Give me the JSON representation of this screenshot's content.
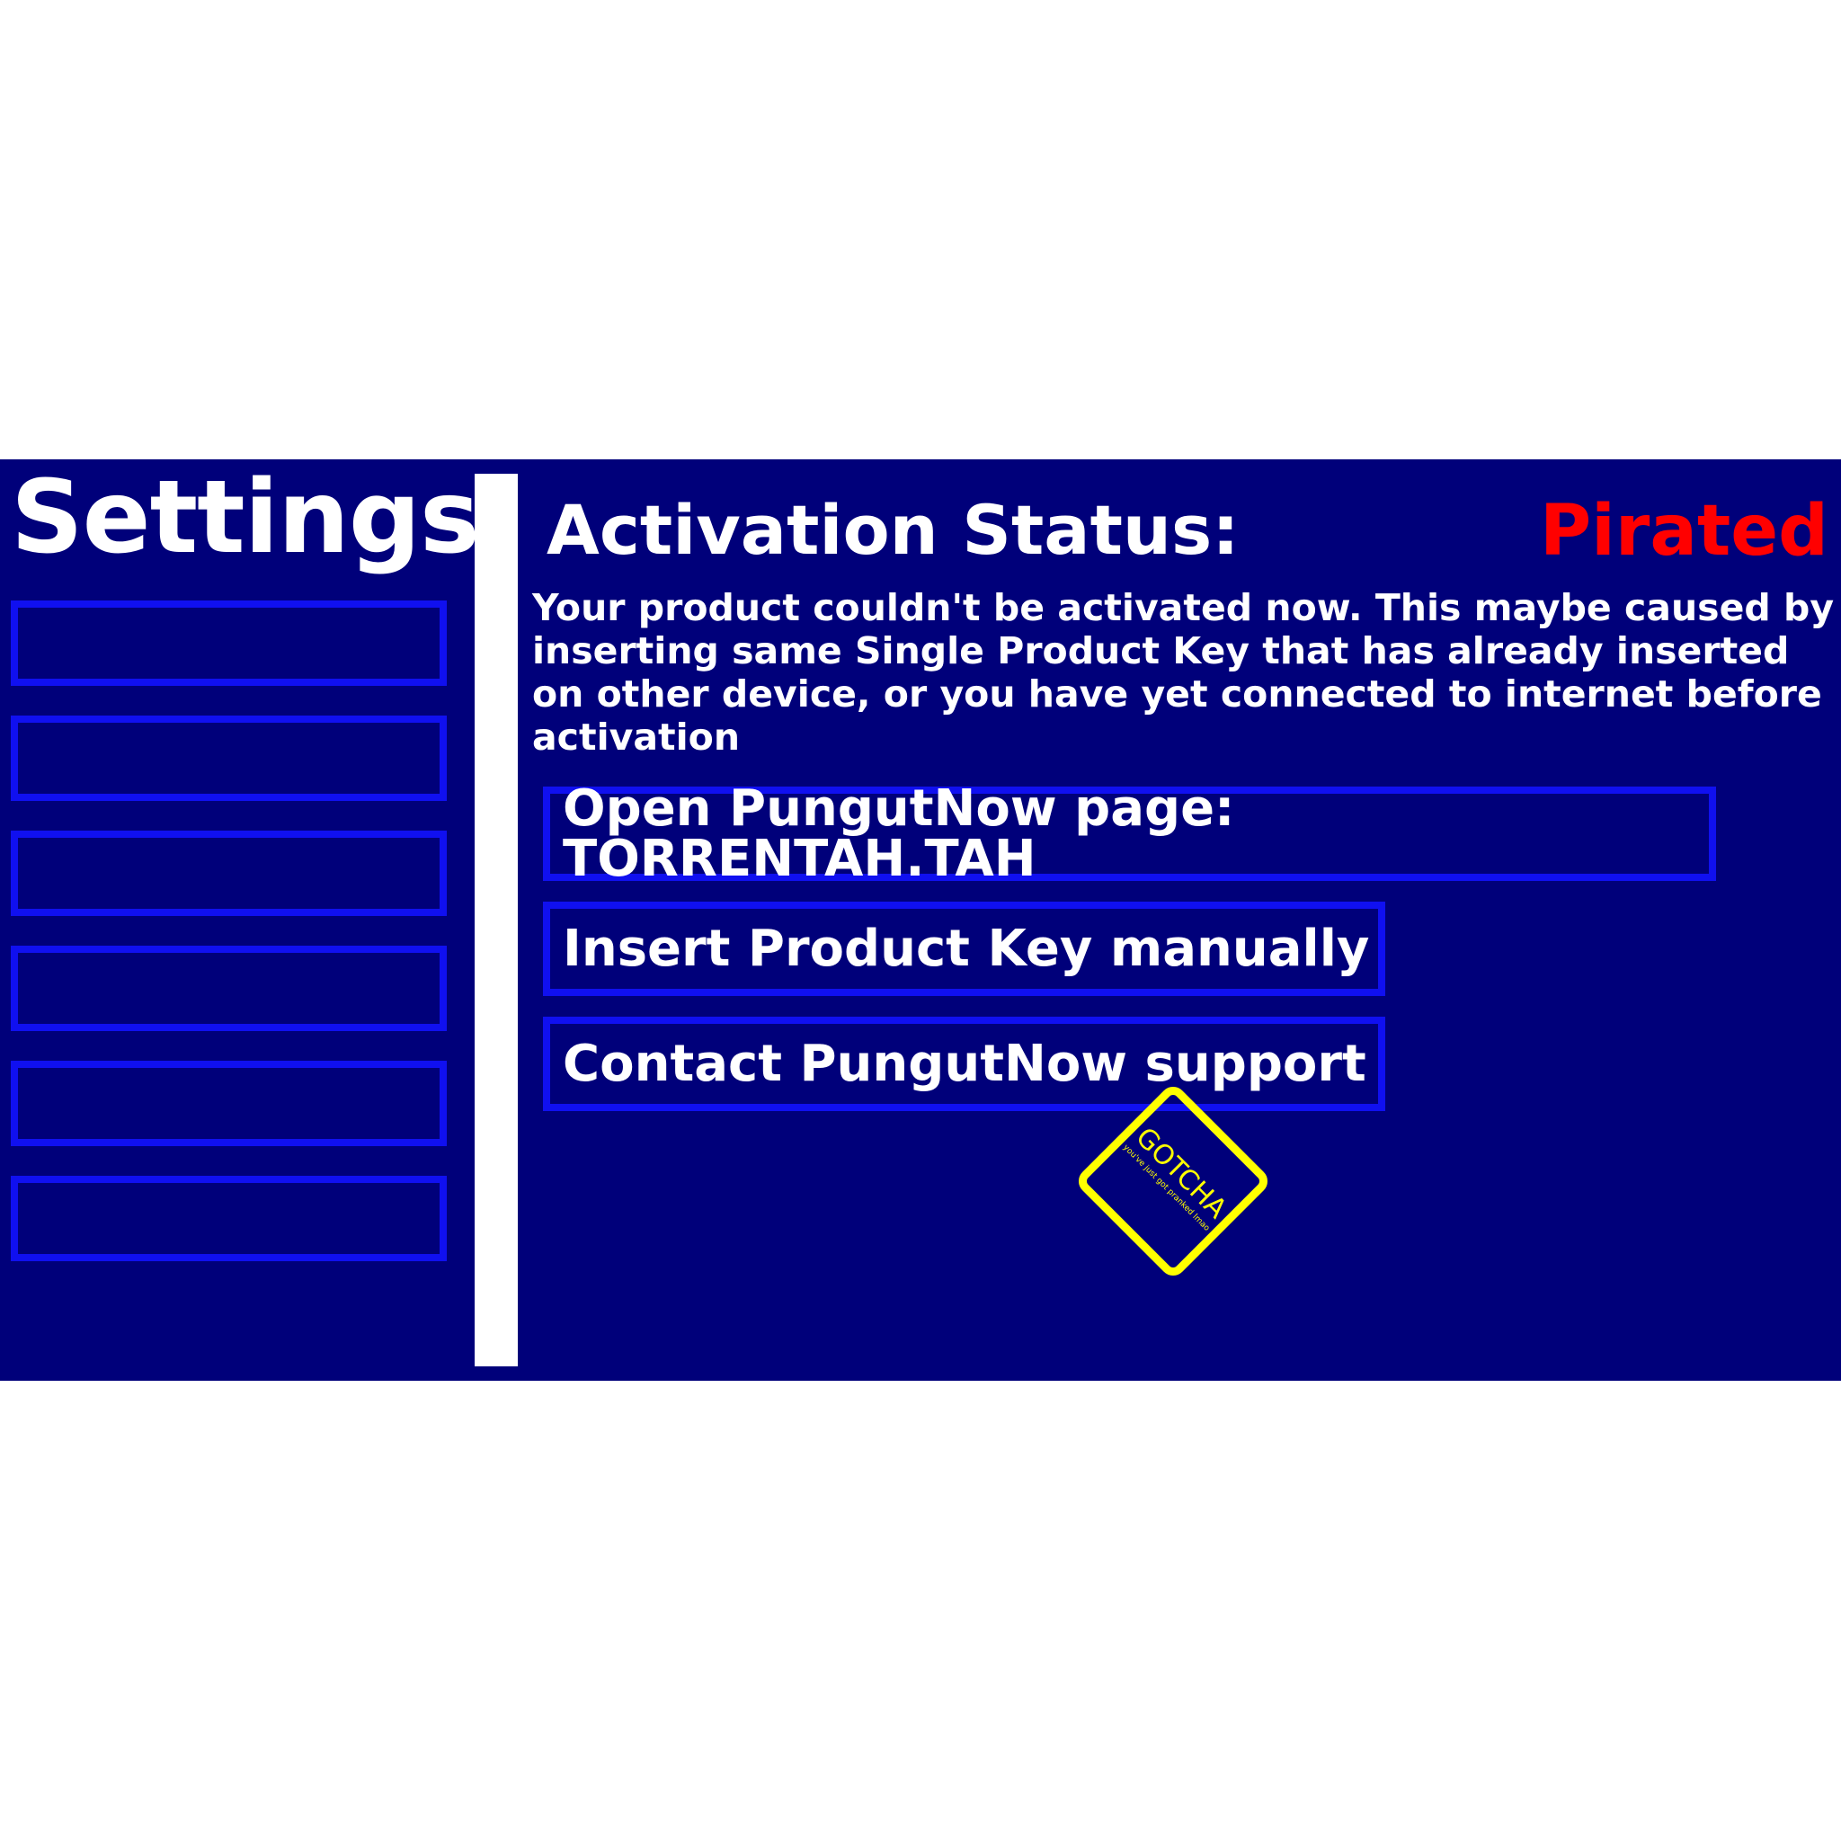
{
  "sidebar": {
    "title": "Settings",
    "items": [
      {
        "label": ""
      },
      {
        "label": ""
      },
      {
        "label": ""
      },
      {
        "label": ""
      },
      {
        "label": ""
      },
      {
        "label": ""
      }
    ]
  },
  "activation": {
    "label": "Activation Status:",
    "status": "Pirated",
    "message": "Your product couldn't be activated now. This maybe caused by inserting same Single Product Key that has already inserted on other device, or you have yet connected to internet before activation"
  },
  "actions": {
    "open_page": "Open PungutNow page: TORRENTAH.TAH",
    "insert_key": "Insert Product Key manually",
    "contact_support": "Contact PungutNow support"
  },
  "stamp": {
    "title": "GOTCHA",
    "subtitle": "you've just got pranked lmao"
  },
  "colors": {
    "panel_background": "#00007a",
    "button_border": "#1010f0",
    "status_pirated": "#ff0000",
    "stamp": "#ffff00"
  }
}
